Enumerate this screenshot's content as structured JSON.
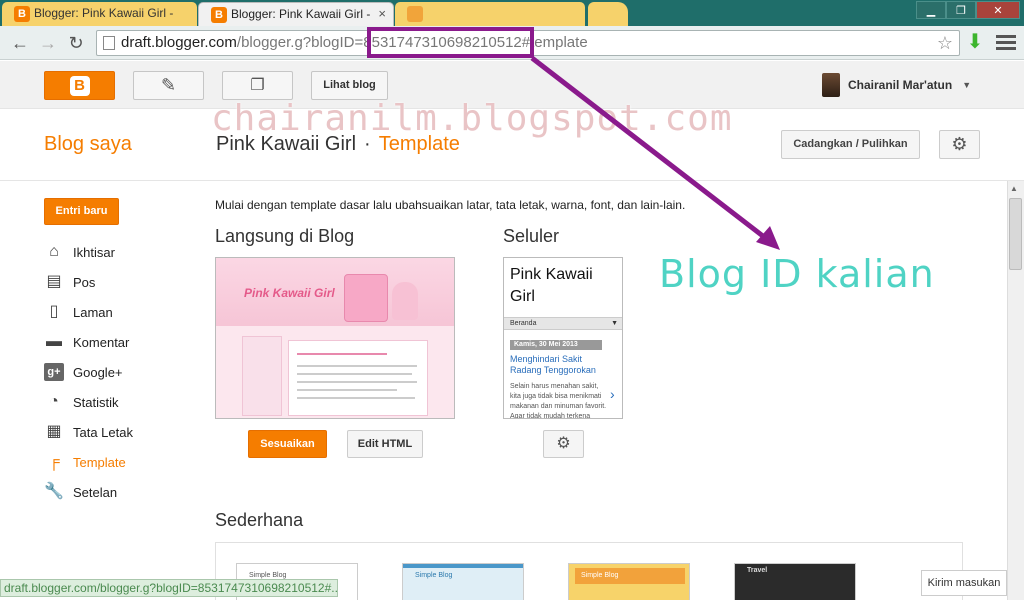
{
  "browser": {
    "tabs": [
      {
        "label": "Blogger: Pink Kawaii Girl -"
      },
      {
        "label": "Blogger: Pink Kawaii Girl -"
      }
    ],
    "url_host": "draft.blogger.com",
    "url_path_prefix": "/blogger.g?blogID=",
    "url_blog_id": "8531747310698210512",
    "url_suffix": "#template"
  },
  "header": {
    "logo_letter": "B",
    "view_blog_label": "Lihat blog",
    "user_name": "Chairanil Mar'atun"
  },
  "page": {
    "my_blogs": "Blog saya",
    "blog_name": "Pink Kawaii Girl",
    "separator": "·",
    "current_section": "Template",
    "backup_label": "Cadangkan / Pulihkan"
  },
  "sidebar": {
    "new_post": "Entri baru",
    "items": [
      {
        "label": "Ikhtisar",
        "icon": "home-icon"
      },
      {
        "label": "Pos",
        "icon": "posts-icon"
      },
      {
        "label": "Laman",
        "icon": "pages-icon"
      },
      {
        "label": "Komentar",
        "icon": "comments-icon"
      },
      {
        "label": "Google+",
        "icon": "google-plus-icon"
      },
      {
        "label": "Statistik",
        "icon": "stats-icon"
      },
      {
        "label": "Tata Letak",
        "icon": "layout-icon"
      },
      {
        "label": "Template",
        "icon": "template-icon"
      },
      {
        "label": "Setelan",
        "icon": "wrench-icon"
      }
    ]
  },
  "main": {
    "intro": "Mulai dengan template dasar lalu ubahsuaikan latar, tata letak, warna, font, dan lain-lain.",
    "live_title": "Langsung di Blog",
    "mobile_title": "Seluler",
    "simple_title": "Sederhana",
    "customize_label": "Sesuaikan",
    "edit_html_label": "Edit HTML",
    "desktop_preview_title": "Pink Kawaii Girl",
    "mobile_preview": {
      "title": "Pink Kawaii Girl",
      "nav": "Beranda",
      "date": "Kamis, 30 Mei 2013",
      "post_title": "Menghindari Sakit Radang Tenggorokan",
      "post_body": "Selain harus menahan sakit, kita juga tidak bisa menikmati makanan dan minuman favorit. Agar tidak mudah terkena"
    },
    "simple_thumbs": [
      "Simple Blog",
      "Simple Blog",
      "Simple Blog",
      "Travel"
    ]
  },
  "status_text": "draft.blogger.com/blogger.g?blogID=8531747310698210512#...",
  "feedback_label": "Kirim masukan",
  "overlay": {
    "watermark": "chairanilm.blogspot.com",
    "annotation": "Blog ID kalian",
    "accent": "#8a1a8c",
    "annotation_color": "#4fd3c4"
  }
}
